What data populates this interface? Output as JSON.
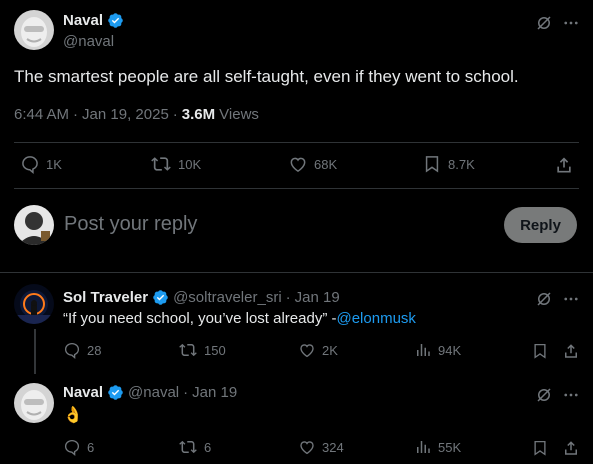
{
  "main_post": {
    "author_name": "Naval",
    "author_handle": "@naval",
    "text": "The smartest people are all self-taught, even if they went to school.",
    "time": "6:44 AM",
    "sep": "·",
    "date": "Jan 19, 2025",
    "views_count": "3.6M",
    "views_label": "Views",
    "stats": {
      "replies": "1K",
      "reposts": "10K",
      "likes": "68K",
      "bookmarks": "8.7K"
    }
  },
  "composer": {
    "placeholder": "Post your reply",
    "reply_label": "Reply"
  },
  "replies": [
    {
      "author_name": "Sol Traveler",
      "author_handle": "@soltraveler_sri",
      "sep": "·",
      "date": "Jan 19",
      "text_prefix": "“If you need school, you’ve lost already” -",
      "mention": "@elonmusk",
      "stats": {
        "replies": "28",
        "reposts": "150",
        "likes": "2K",
        "views": "94K"
      }
    },
    {
      "author_name": "Naval",
      "author_handle": "@naval",
      "sep": "·",
      "date": "Jan 19",
      "text": "👌",
      "stats": {
        "replies": "6",
        "reposts": "6",
        "likes": "324",
        "views": "55K"
      }
    }
  ],
  "colors": {
    "background": "#000000",
    "text": "#e7e9ea",
    "muted": "#71767b",
    "verified": "#1d9bf0",
    "divider": "#2f3336",
    "reply_button": "#787a7a"
  }
}
